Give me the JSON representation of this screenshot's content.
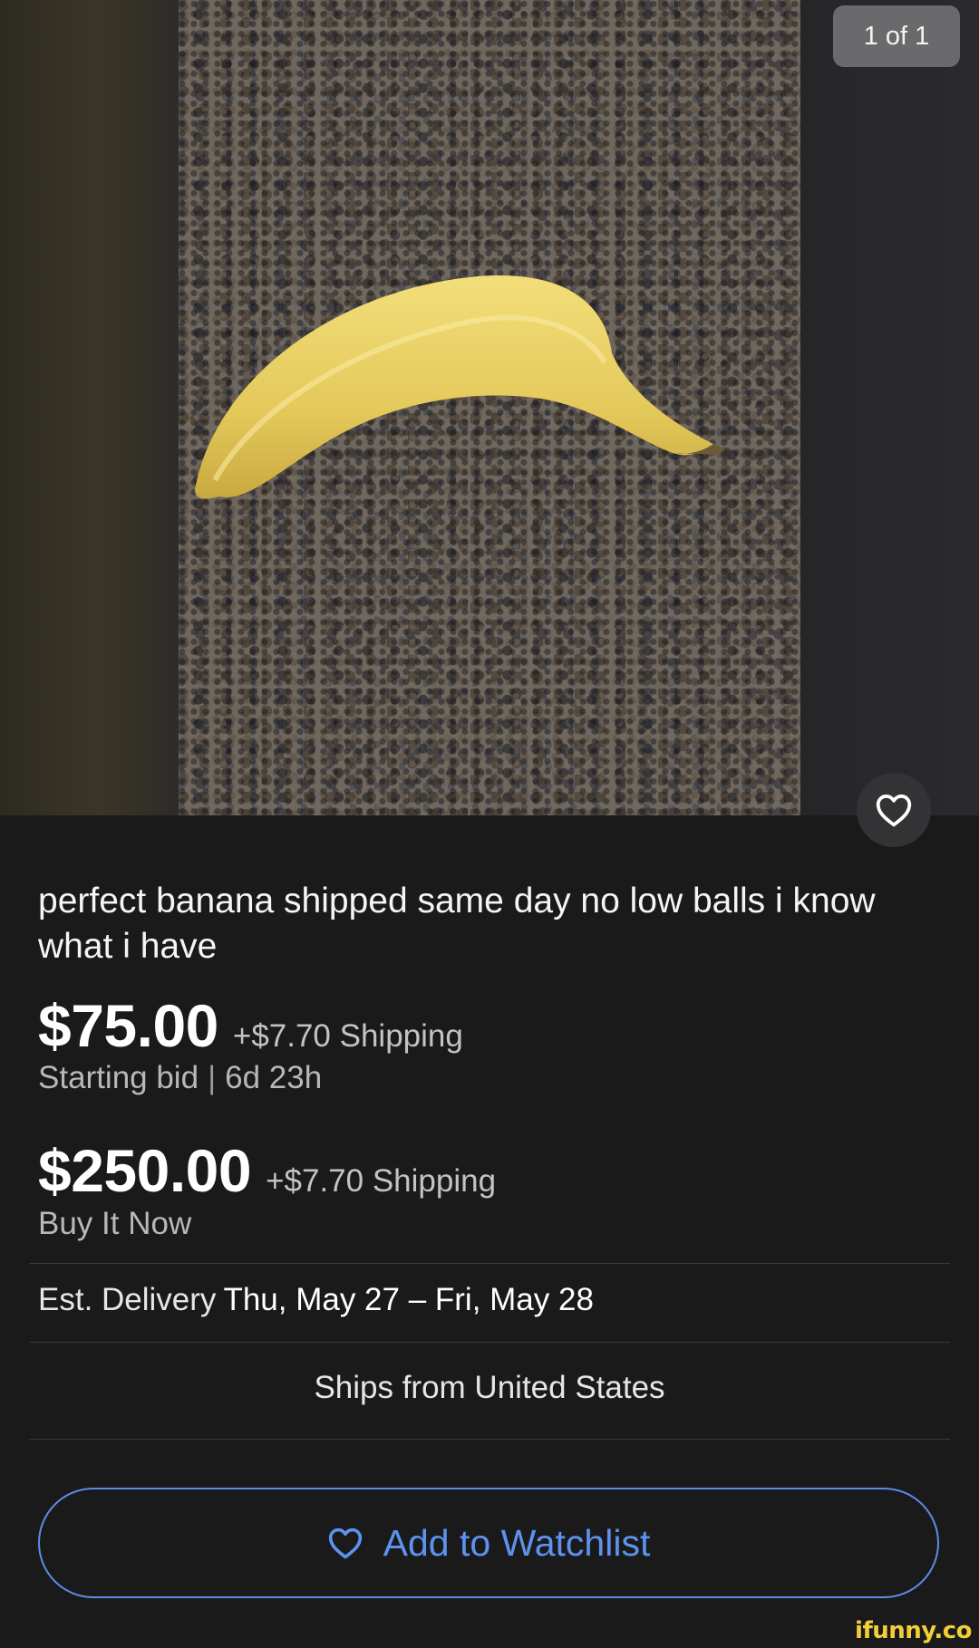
{
  "gallery": {
    "counter": "1 of 1",
    "favorite_icon": "heart-icon"
  },
  "listing": {
    "title": "perfect banana shipped same day no low balls i know what i have",
    "bid": {
      "price": "$75.00",
      "shipping": "+$7.70 Shipping",
      "label": "Starting bid",
      "separator": "|",
      "time_left": "6d 23h"
    },
    "buy_now": {
      "price": "$250.00",
      "shipping": "+$7.70 Shipping",
      "label": "Buy It Now"
    },
    "delivery": {
      "label": "Est. Delivery",
      "dates": "Thu, May 27 – Fri, May 28"
    },
    "ships_from": "Ships from United States"
  },
  "actions": {
    "watchlist_label": "Add to Watchlist",
    "watchlist_icon": "heart-icon"
  },
  "watermark": "ifunny.co",
  "colors": {
    "background": "#1a1a1b",
    "accent": "#5d93ef",
    "brand": "#f2cf3a"
  }
}
